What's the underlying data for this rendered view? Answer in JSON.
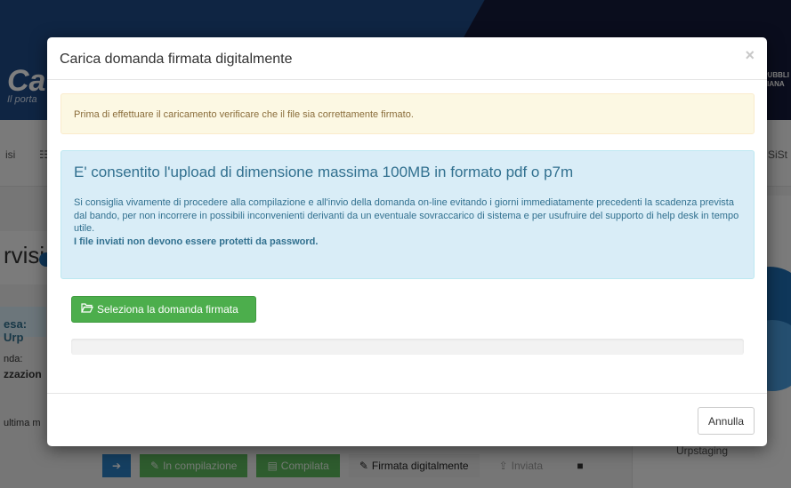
{
  "background": {
    "brand": "Ca",
    "tagline": "Il porta",
    "republic_line1": "PUBBLI",
    "republic_line2": "LIANA",
    "nav_left_1": "isi",
    "nav_left_2": "☷",
    "nav_right": "i SiSt",
    "page_title": "rvisi",
    "strip_text": "esa: Urp",
    "label_domanda": "nda:",
    "label_zzazione": "zzazion",
    "label_ultima": "ultima m",
    "right_text": "Urpstaging",
    "steps": {
      "first_icon": "➔",
      "in_compilazione": "In compilazione",
      "compilata": "Compilata",
      "firmata": "Firmata digitalmente",
      "inviata": "Inviata",
      "lock": "🔒"
    }
  },
  "modal": {
    "title": "Carica domanda firmata digitalmente",
    "close": "×",
    "warning": "Prima di effettuare il caricamento verificare che il file sia correttamente firmato.",
    "info": {
      "heading": "E' consentito l'upload di dimensione massima 100MB in formato pdf o p7m",
      "text": "Si consiglia vivamente di procedere alla compilazione e all'invio della domanda on-line evitando i giorni immediatamente precedenti la scadenza prevista dal bando, per non incorrere in possibili inconvenienti derivanti da un eventuale sovraccarico di sistema e per usufruire del supporto di help desk in tempo utile.",
      "bold": "I file inviati non devono essere protetti da password."
    },
    "select_button": "Seleziona la domanda firmata",
    "select_icon": "folder-open-icon",
    "upload_progress": 0,
    "cancel_button": "Annulla"
  },
  "colors": {
    "warning_bg": "#fcf8e3",
    "info_bg": "#d9edf7",
    "success": "#4cae4c",
    "header_blue": "#1f4a86"
  }
}
